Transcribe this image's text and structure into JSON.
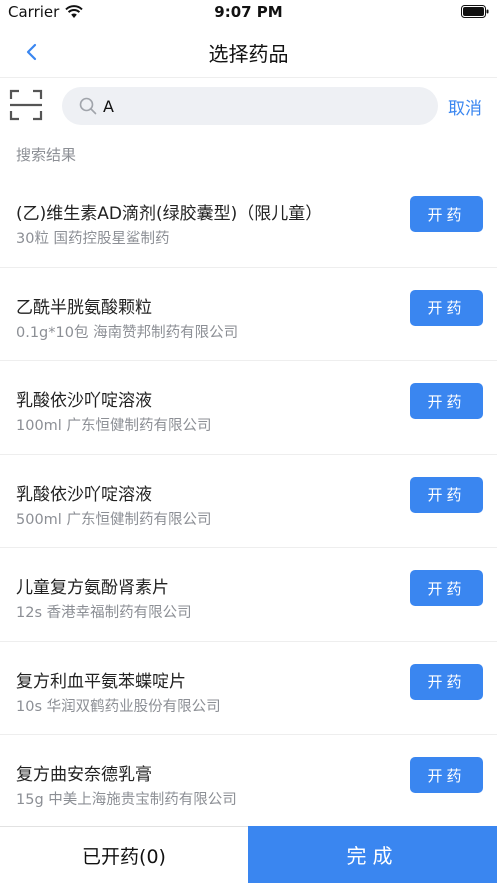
{
  "status_bar": {
    "carrier": "Carrier",
    "time": "9:07 PM",
    "icons": [
      "wifi-icon",
      "battery-icon"
    ]
  },
  "nav": {
    "title": "选择药品",
    "back_icon": "chevron-left-icon"
  },
  "search": {
    "value": "A",
    "placeholder": "",
    "cancel_label": "取消",
    "scan_icon": "scan-icon"
  },
  "results": {
    "label": "搜索结果",
    "items": [
      {
        "name": "(乙)维生素AD滴剂(绿胶囊型)（限儿童）",
        "desc": "30粒 国药控股星鲨制药",
        "button": "开药"
      },
      {
        "name": "乙酰半胱氨酸颗粒",
        "desc": "0.1g*10包 海南赞邦制药有限公司",
        "button": "开药"
      },
      {
        "name": "乳酸依沙吖啶溶液",
        "desc": "100ml 广东恒健制药有限公司",
        "button": "开药"
      },
      {
        "name": "乳酸依沙吖啶溶液",
        "desc": "500ml 广东恒健制药有限公司",
        "button": "开药"
      },
      {
        "name": "儿童复方氨酚肾素片",
        "desc": "12s 香港幸福制药有限公司",
        "button": "开药"
      },
      {
        "name": "复方利血平氨苯蝶啶片",
        "desc": "10s 华润双鹤药业股份有限公司",
        "button": "开药"
      },
      {
        "name": "复方曲安奈德乳膏",
        "desc": "15g 中美上海施贵宝制药有限公司",
        "button": "开药"
      }
    ]
  },
  "bottom": {
    "prescribed_label": "已开药(0)",
    "done_label": "完成"
  },
  "colors": {
    "accent": "#3a86f0",
    "secondary_text": "#8c8f95",
    "search_bg": "#eef0f4"
  }
}
